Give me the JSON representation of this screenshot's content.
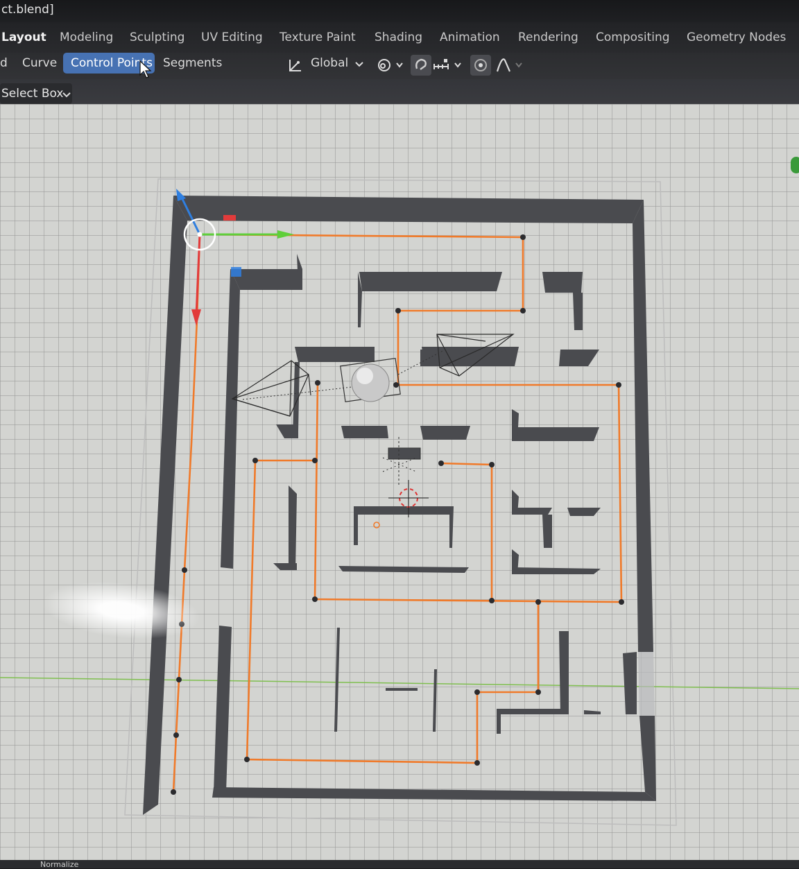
{
  "window": {
    "title": "ct.blend]"
  },
  "workspace_tabs": [
    {
      "label": "Layout",
      "active": true
    },
    {
      "label": "Modeling",
      "active": false
    },
    {
      "label": "Sculpting",
      "active": false
    },
    {
      "label": "UV Editing",
      "active": false
    },
    {
      "label": "Texture Paint",
      "active": false
    },
    {
      "label": "Shading",
      "active": false
    },
    {
      "label": "Animation",
      "active": false
    },
    {
      "label": "Rendering",
      "active": false
    },
    {
      "label": "Compositing",
      "active": false
    },
    {
      "label": "Geometry Nodes",
      "active": false
    }
  ],
  "header": {
    "menu": [
      "d",
      "Curve"
    ],
    "select_mode_active": "Control Points",
    "select_mode_other": "Segments",
    "transform_orientation": "Global",
    "icons": [
      "transform-orientation-icon",
      "pivot-point-icon",
      "snap-icon",
      "snap-increment-icon",
      "proportional-editing-icon",
      "falloff-curve-icon"
    ]
  },
  "tool_header": {
    "select_tool": "Select Box"
  },
  "status_bar": {
    "text": "Normalize"
  },
  "colors": {
    "curve": "#f07a2a",
    "wall": "#4a4b4f",
    "grid_bg": "#d3d4d1",
    "axis_x": "#5fcf3a",
    "axis_y": "#e23b3b",
    "axis_z": "#2f7fe0",
    "active_button": "#4772b3"
  }
}
